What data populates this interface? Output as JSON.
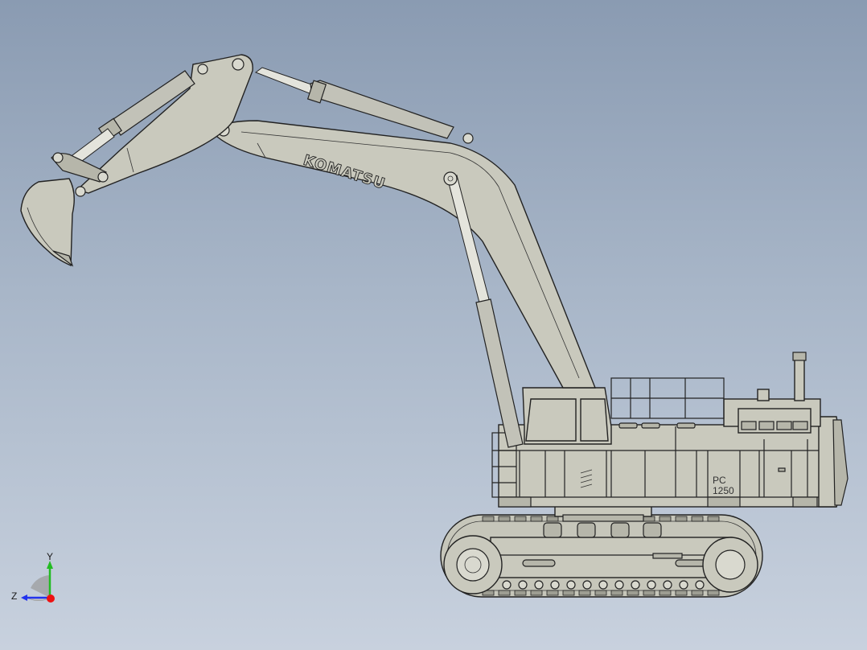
{
  "viewport": {
    "background_top": "#8a9bb2",
    "background_bottom": "#c8d1de"
  },
  "model": {
    "brand_logo": "KOMATSU",
    "model_plate_line1": "PC",
    "model_plate_line2": "1250",
    "body_color": "#c9c9bd",
    "edge_color": "#222222"
  },
  "triad": {
    "y_label": "Y",
    "z_label": "Z",
    "y_color": "#22bb22",
    "z_color": "#2233ee",
    "origin_color": "#ee1111"
  }
}
